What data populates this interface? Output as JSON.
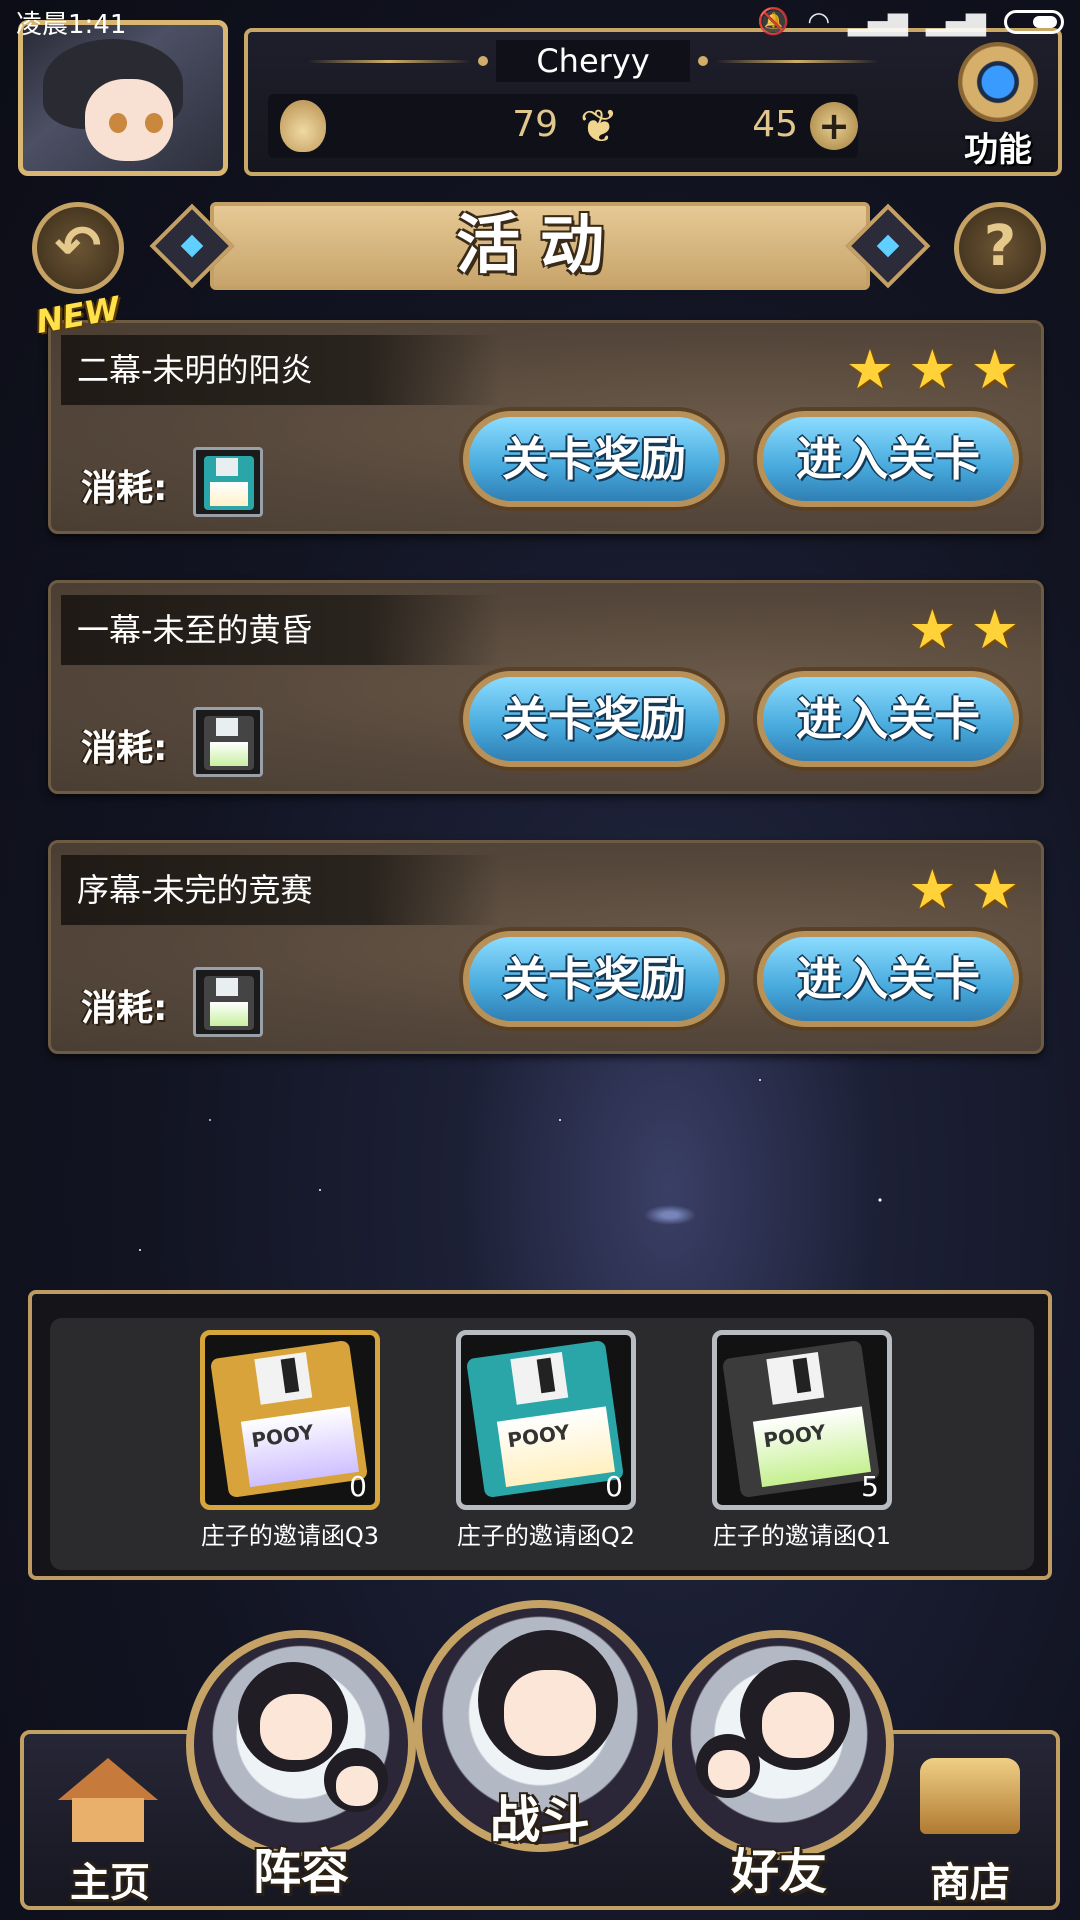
{
  "status_bar": {
    "time": "凌晨1:41"
  },
  "header": {
    "username": "Cheryy",
    "resource1_value": "79",
    "resource2_value": "45",
    "function_label": "功能"
  },
  "title": "活动",
  "new_badge": "NEW",
  "stages": [
    {
      "title": "二幕-未明的阳炎",
      "stars": 3,
      "cost_label": "消耗:",
      "reward_label": "关卡奖励",
      "enter_label": "进入关卡",
      "disk_color": "#2aa6a8",
      "label_color": "#fff1c8"
    },
    {
      "title": "一幕-未至的黄昏",
      "stars": 2,
      "cost_label": "消耗:",
      "reward_label": "关卡奖励",
      "enter_label": "进入关卡",
      "disk_color": "#444444",
      "label_color": "#c5f090"
    },
    {
      "title": "序幕-未完的竞赛",
      "stars": 2,
      "cost_label": "消耗:",
      "reward_label": "关卡奖励",
      "enter_label": "进入关卡",
      "disk_color": "#444444",
      "label_color": "#c5f090"
    }
  ],
  "inventory": [
    {
      "name": "庄子的邀请函Q3",
      "count": "0",
      "disk_color": "#d7a33a"
    },
    {
      "name": "庄子的邀请函Q2",
      "count": "0",
      "disk_color": "#2aa6a8"
    },
    {
      "name": "庄子的邀请函Q1",
      "count": "5",
      "disk_color": "#3b3b3b"
    }
  ],
  "nav": {
    "home": "主页",
    "lineup": "阵容",
    "battle": "战斗",
    "friends": "好友",
    "shop": "商店"
  },
  "colors": {
    "accent_gold": "#c9a867",
    "button_blue": "#47a9dc",
    "star_yellow": "#ffd23a"
  }
}
